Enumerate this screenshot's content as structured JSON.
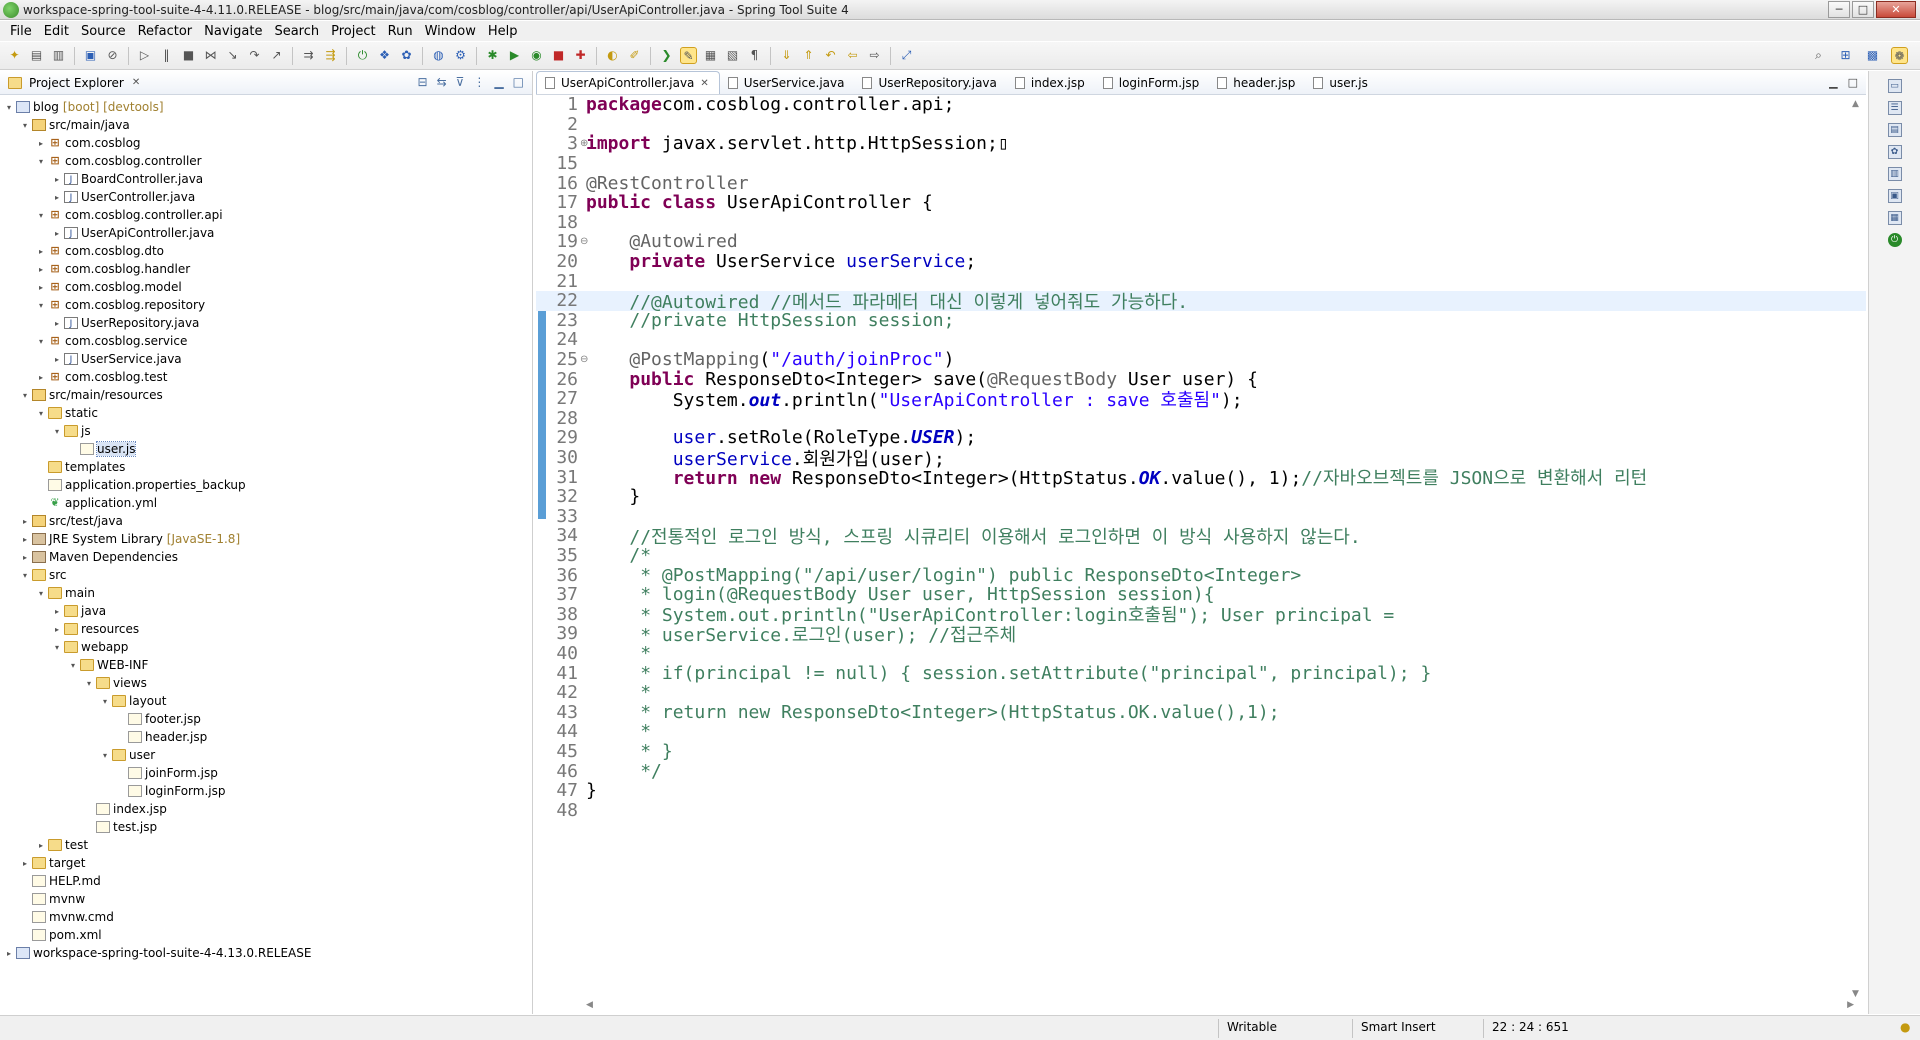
{
  "window": {
    "title": "workspace-spring-tool-suite-4-4.11.0.RELEASE - blog/src/main/java/com/cosblog/controller/api/UserApiController.java - Spring Tool Suite 4",
    "controls": [
      "─",
      "□",
      "✕"
    ]
  },
  "menu": [
    "File",
    "Edit",
    "Source",
    "Refactor",
    "Navigate",
    "Search",
    "Project",
    "Run",
    "Window",
    "Help"
  ],
  "project_explorer": {
    "title": "Project Explorer",
    "tree": [
      {
        "depth": 0,
        "toggle": "▾",
        "icon": "project",
        "label": "blog",
        "decor": "[boot] [devtools]"
      },
      {
        "depth": 1,
        "toggle": "▾",
        "icon": "srcfolder",
        "label": "src/main/java"
      },
      {
        "depth": 2,
        "toggle": "▸",
        "icon": "package",
        "label": "com.cosblog"
      },
      {
        "depth": 2,
        "toggle": "▾",
        "icon": "package",
        "label": "com.cosblog.controller"
      },
      {
        "depth": 3,
        "toggle": "▸",
        "icon": "java",
        "label": "BoardController.java"
      },
      {
        "depth": 3,
        "toggle": "▸",
        "icon": "java",
        "label": "UserController.java"
      },
      {
        "depth": 2,
        "toggle": "▾",
        "icon": "package",
        "label": "com.cosblog.controller.api"
      },
      {
        "depth": 3,
        "toggle": "▸",
        "icon": "java",
        "label": "UserApiController.java"
      },
      {
        "depth": 2,
        "toggle": "▸",
        "icon": "package",
        "label": "com.cosblog.dto"
      },
      {
        "depth": 2,
        "toggle": "▸",
        "icon": "package",
        "label": "com.cosblog.handler"
      },
      {
        "depth": 2,
        "toggle": "▸",
        "icon": "package",
        "label": "com.cosblog.model"
      },
      {
        "depth": 2,
        "toggle": "▾",
        "icon": "package",
        "label": "com.cosblog.repository"
      },
      {
        "depth": 3,
        "toggle": "▸",
        "icon": "java",
        "label": "UserRepository.java"
      },
      {
        "depth": 2,
        "toggle": "▾",
        "icon": "package",
        "label": "com.cosblog.service"
      },
      {
        "depth": 3,
        "toggle": "▸",
        "icon": "java",
        "label": "UserService.java"
      },
      {
        "depth": 2,
        "toggle": "▸",
        "icon": "package",
        "label": "com.cosblog.test"
      },
      {
        "depth": 1,
        "toggle": "▾",
        "icon": "srcfolder",
        "label": "src/main/resources"
      },
      {
        "depth": 2,
        "toggle": "▾",
        "icon": "folder",
        "label": "static"
      },
      {
        "depth": 3,
        "toggle": "▾",
        "icon": "folder",
        "label": "js"
      },
      {
        "depth": 4,
        "toggle": "",
        "icon": "file",
        "label": "user.js",
        "selected": true
      },
      {
        "depth": 2,
        "toggle": "",
        "icon": "folder",
        "label": "templates"
      },
      {
        "depth": 2,
        "toggle": "",
        "icon": "file",
        "label": "application.properties_backup"
      },
      {
        "depth": 2,
        "toggle": "",
        "icon": "yml",
        "label": "application.yml"
      },
      {
        "depth": 1,
        "toggle": "▸",
        "icon": "srcfolder",
        "label": "src/test/java"
      },
      {
        "depth": 1,
        "toggle": "▸",
        "icon": "lib",
        "label": "JRE System Library",
        "decor": "[JavaSE-1.8]"
      },
      {
        "depth": 1,
        "toggle": "▸",
        "icon": "lib",
        "label": "Maven Dependencies"
      },
      {
        "depth": 1,
        "toggle": "▾",
        "icon": "folder",
        "label": "src"
      },
      {
        "depth": 2,
        "toggle": "▾",
        "icon": "folder",
        "label": "main"
      },
      {
        "depth": 3,
        "toggle": "▸",
        "icon": "folder",
        "label": "java"
      },
      {
        "depth": 3,
        "toggle": "▸",
        "icon": "folder",
        "label": "resources"
      },
      {
        "depth": 3,
        "toggle": "▾",
        "icon": "folder",
        "label": "webapp"
      },
      {
        "depth": 4,
        "toggle": "▾",
        "icon": "folder",
        "label": "WEB-INF"
      },
      {
        "depth": 5,
        "toggle": "▾",
        "icon": "folder",
        "label": "views"
      },
      {
        "depth": 6,
        "toggle": "▾",
        "icon": "folder",
        "label": "layout"
      },
      {
        "depth": 7,
        "toggle": "",
        "icon": "file",
        "label": "footer.jsp"
      },
      {
        "depth": 7,
        "toggle": "",
        "icon": "file",
        "label": "header.jsp"
      },
      {
        "depth": 6,
        "toggle": "▾",
        "icon": "folder",
        "label": "user"
      },
      {
        "depth": 7,
        "toggle": "",
        "icon": "file",
        "label": "joinForm.jsp"
      },
      {
        "depth": 7,
        "toggle": "",
        "icon": "file",
        "label": "loginForm.jsp"
      },
      {
        "depth": 5,
        "toggle": "",
        "icon": "file",
        "label": "index.jsp"
      },
      {
        "depth": 5,
        "toggle": "",
        "icon": "file",
        "label": "test.jsp"
      },
      {
        "depth": 2,
        "toggle": "▸",
        "icon": "folder",
        "label": "test"
      },
      {
        "depth": 1,
        "toggle": "▸",
        "icon": "folder",
        "label": "target"
      },
      {
        "depth": 1,
        "toggle": "",
        "icon": "file",
        "label": "HELP.md"
      },
      {
        "depth": 1,
        "toggle": "",
        "icon": "file",
        "label": "mvnw"
      },
      {
        "depth": 1,
        "toggle": "",
        "icon": "file",
        "label": "mvnw.cmd"
      },
      {
        "depth": 1,
        "toggle": "",
        "icon": "file",
        "label": "pom.xml"
      },
      {
        "depth": 0,
        "toggle": "▸",
        "icon": "project",
        "label": "workspace-spring-tool-suite-4-4.13.0.RELEASE"
      }
    ]
  },
  "editor": {
    "tabs": [
      {
        "label": "UserApiController.java",
        "active": true,
        "closable": true
      },
      {
        "label": "UserService.java"
      },
      {
        "label": "UserRepository.java"
      },
      {
        "label": "index.jsp"
      },
      {
        "label": "loginForm.jsp"
      },
      {
        "label": "header.jsp"
      },
      {
        "label": "user.js"
      }
    ],
    "current_line": "22",
    "lines": [
      {
        "n": "1",
        "fold": "",
        "tokens": [
          [
            "kw",
            "package"
          ],
          [
            "",
            "com.cosblog.controller.api;"
          ]
        ]
      },
      {
        "n": "2",
        "fold": "",
        "tokens": []
      },
      {
        "n": "3",
        "fold": "⊕",
        "tokens": [
          [
            "kw",
            "import"
          ],
          [
            "",
            " javax.servlet.http.HttpSession;"
          ],
          [
            "",
            "▯"
          ]
        ]
      },
      {
        "n": "15",
        "fold": "",
        "tokens": []
      },
      {
        "n": "16",
        "fold": "",
        "tokens": [
          [
            "ann",
            "@RestController"
          ]
        ]
      },
      {
        "n": "17",
        "fold": "",
        "tokens": [
          [
            "kw",
            "public"
          ],
          [
            "",
            " "
          ],
          [
            "kw",
            "class"
          ],
          [
            "",
            " UserApiController {"
          ]
        ]
      },
      {
        "n": "18",
        "fold": "",
        "tokens": []
      },
      {
        "n": "19",
        "fold": "⊖",
        "tokens": [
          [
            "",
            "    "
          ],
          [
            "ann",
            "@Autowired"
          ]
        ]
      },
      {
        "n": "20",
        "fold": "",
        "tokens": [
          [
            "",
            "    "
          ],
          [
            "kw",
            "private"
          ],
          [
            "",
            " UserService "
          ],
          [
            "fld",
            "userService"
          ],
          [
            "",
            ";"
          ]
        ]
      },
      {
        "n": "21",
        "fold": "",
        "tokens": []
      },
      {
        "n": "22",
        "fold": "",
        "tokens": [
          [
            "",
            "    "
          ],
          [
            "cm",
            "//@Autowired //메서드 파라메터 대신 이렇게 넣어줘도 가능하다."
          ]
        ]
      },
      {
        "n": "23",
        "fold": "",
        "tokens": [
          [
            "",
            "    "
          ],
          [
            "cm",
            "//private HttpSession session;"
          ]
        ]
      },
      {
        "n": "24",
        "fold": "",
        "tokens": []
      },
      {
        "n": "25",
        "fold": "⊖",
        "tokens": [
          [
            "",
            "    "
          ],
          [
            "ann",
            "@PostMapping"
          ],
          [
            "",
            "("
          ],
          [
            "str",
            "\"/auth/joinProc\""
          ],
          [
            "",
            ")"
          ]
        ]
      },
      {
        "n": "26",
        "fold": "",
        "tokens": [
          [
            "",
            "    "
          ],
          [
            "kw",
            "public"
          ],
          [
            "",
            " ResponseDto<Integer> save("
          ],
          [
            "ann",
            "@RequestBody"
          ],
          [
            "",
            " User user) {"
          ]
        ]
      },
      {
        "n": "27",
        "fold": "",
        "tokens": [
          [
            "",
            "        System."
          ],
          [
            "sfld",
            "out"
          ],
          [
            "",
            ".println("
          ],
          [
            "str",
            "\"UserApiController : save 호출됨\""
          ],
          [
            "",
            ");"
          ]
        ]
      },
      {
        "n": "28",
        "fold": "",
        "tokens": []
      },
      {
        "n": "29",
        "fold": "",
        "tokens": [
          [
            "",
            "        "
          ],
          [
            "fld",
            "user"
          ],
          [
            "",
            ".setRole(RoleType."
          ],
          [
            "sfld",
            "USER"
          ],
          [
            "",
            ");"
          ]
        ]
      },
      {
        "n": "30",
        "fold": "",
        "tokens": [
          [
            "",
            "        "
          ],
          [
            "fld",
            "userService"
          ],
          [
            "",
            ".회원가입(user);"
          ]
        ]
      },
      {
        "n": "31",
        "fold": "",
        "tokens": [
          [
            "",
            "        "
          ],
          [
            "kw",
            "return"
          ],
          [
            "",
            " "
          ],
          [
            "kw",
            "new"
          ],
          [
            "",
            " ResponseDto<Integer>(HttpStatus."
          ],
          [
            "sfld",
            "OK"
          ],
          [
            "",
            ".value(), 1);"
          ],
          [
            "cm",
            "//자바오브젝트를 JSON으로 변환해서 리턴"
          ]
        ]
      },
      {
        "n": "32",
        "fold": "",
        "tokens": [
          [
            "",
            "    }"
          ]
        ]
      },
      {
        "n": "33",
        "fold": "",
        "tokens": []
      },
      {
        "n": "34",
        "fold": "",
        "tokens": [
          [
            "",
            "    "
          ],
          [
            "cm",
            "//전통적인 로그인 방식, 스프링 시큐리티 이용해서 로그인하면 이 방식 사용하지 않는다."
          ]
        ]
      },
      {
        "n": "35",
        "fold": "",
        "tokens": [
          [
            "",
            "    "
          ],
          [
            "cm",
            "/*"
          ]
        ]
      },
      {
        "n": "36",
        "fold": "",
        "tokens": [
          [
            "",
            "     "
          ],
          [
            "cm",
            "* @PostMapping(\"/api/user/login\") public ResponseDto<Integer>"
          ]
        ]
      },
      {
        "n": "37",
        "fold": "",
        "tokens": [
          [
            "",
            "     "
          ],
          [
            "cm",
            "* login(@RequestBody User user, HttpSession session){"
          ]
        ]
      },
      {
        "n": "38",
        "fold": "",
        "tokens": [
          [
            "",
            "     "
          ],
          [
            "cm",
            "* System.out.println(\"UserApiController:login호출됨\"); User principal ="
          ]
        ]
      },
      {
        "n": "39",
        "fold": "",
        "tokens": [
          [
            "",
            "     "
          ],
          [
            "cm",
            "* userService.로그인(user); //접근주체"
          ]
        ]
      },
      {
        "n": "40",
        "fold": "",
        "tokens": [
          [
            "",
            "     "
          ],
          [
            "cm",
            "*"
          ]
        ]
      },
      {
        "n": "41",
        "fold": "",
        "tokens": [
          [
            "",
            "     "
          ],
          [
            "cm",
            "* if(principal != null) { session.setAttribute(\"principal\", principal); }"
          ]
        ]
      },
      {
        "n": "42",
        "fold": "",
        "tokens": [
          [
            "",
            "     "
          ],
          [
            "cm",
            "*"
          ]
        ]
      },
      {
        "n": "43",
        "fold": "",
        "tokens": [
          [
            "",
            "     "
          ],
          [
            "cm",
            "* return new ResponseDto<Integer>(HttpStatus.OK.value(),1);"
          ]
        ]
      },
      {
        "n": "44",
        "fold": "",
        "tokens": [
          [
            "",
            "     "
          ],
          [
            "cm",
            "*"
          ]
        ]
      },
      {
        "n": "45",
        "fold": "",
        "tokens": [
          [
            "",
            "     "
          ],
          [
            "cm",
            "* }"
          ]
        ]
      },
      {
        "n": "46",
        "fold": "",
        "tokens": [
          [
            "",
            "     "
          ],
          [
            "cm",
            "*/"
          ]
        ]
      },
      {
        "n": "47",
        "fold": "",
        "tokens": [
          [
            "",
            "}"
          ]
        ]
      },
      {
        "n": "48",
        "fold": "",
        "tokens": []
      }
    ]
  },
  "status": {
    "writable": "Writable",
    "insert_mode": "Smart Insert",
    "position": "22 : 24 : 651"
  },
  "colors": {
    "keyword": "#7f0055",
    "string": "#2a00ff",
    "comment": "#3f7f5f",
    "annotation": "#646464",
    "field": "#0000c0",
    "current_line": "#e8f2fe"
  }
}
